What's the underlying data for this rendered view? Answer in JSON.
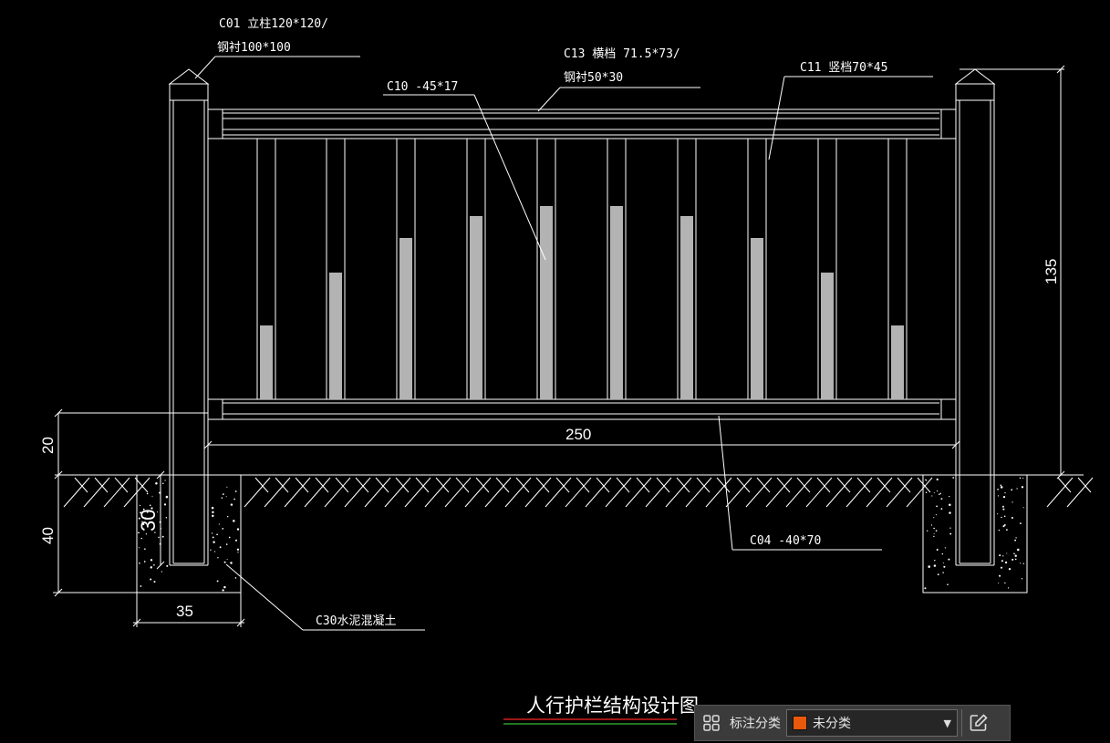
{
  "drawing": {
    "labels": {
      "c01_line1": "C01   立柱120*120/",
      "c01_line2": "钢衬100*100",
      "c13_line1": "C13   横档 71.5*73/",
      "c13_line2": "钢衬50*30",
      "c10": "C10  -45*17",
      "c11": "C11   竖档70*45",
      "c04": "C04  -40*70",
      "c30": "C30水泥混凝土"
    },
    "dimensions": {
      "width": "250",
      "height": "135",
      "above_ground": "20",
      "footing_depth": "40",
      "embed_depth": "30",
      "footing_width": "35"
    },
    "title": "人行护栏结构设计图",
    "colors": {
      "background": "#000000",
      "line": "#ffffff",
      "fill": "#b3b3b3",
      "title_underline_red": "#d11f1f",
      "title_underline_green": "#2f9e2f"
    }
  },
  "toolbar": {
    "grid_icon": "grid-icon",
    "category_label": "标注分类",
    "selected_category": "未分类",
    "swatch_color": "#e8590c",
    "edit_icon": "edit-icon"
  }
}
